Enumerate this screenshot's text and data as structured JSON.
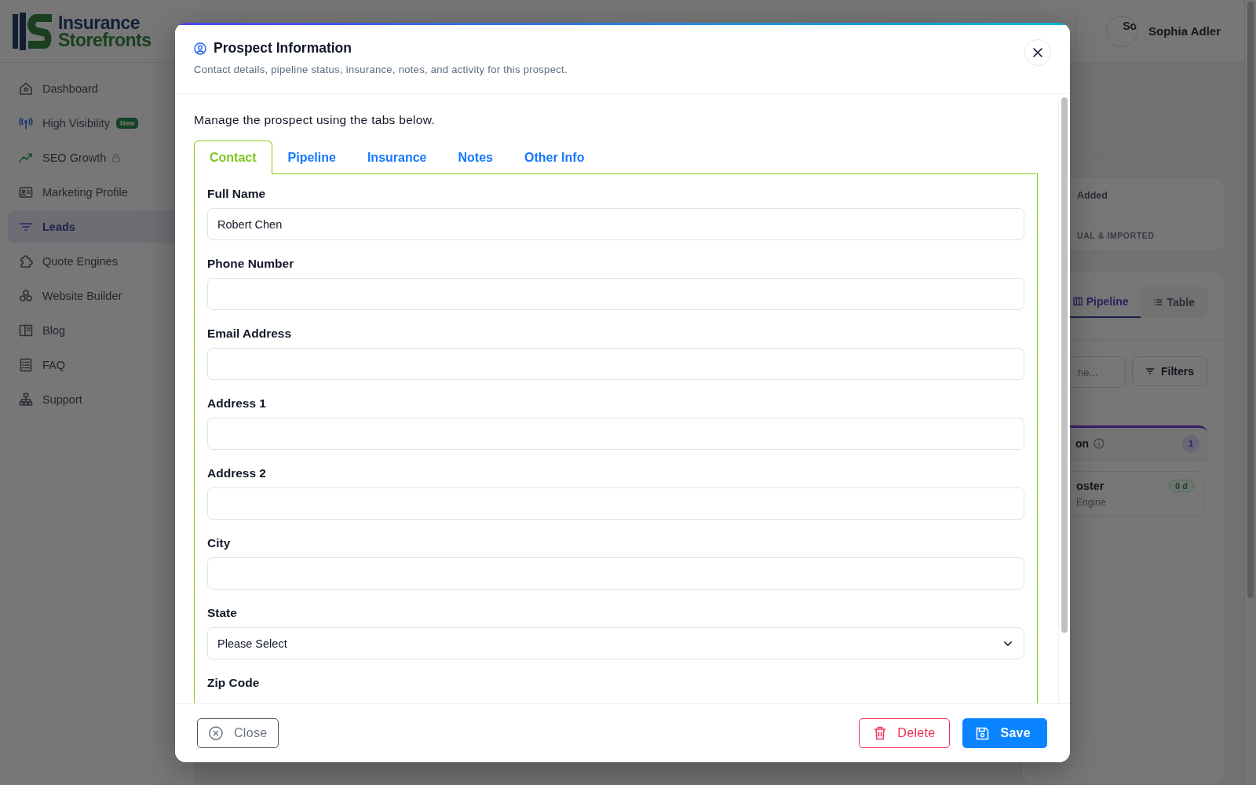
{
  "app": {
    "logo": {
      "line1": "Insurance",
      "line2": "Storefronts"
    },
    "user": {
      "name": "Sophia Adler",
      "avatar_alt": "So"
    }
  },
  "sidebar": {
    "items": [
      {
        "label": "Dashboard",
        "selected": false,
        "locked": false
      },
      {
        "label": "High Visibility",
        "selected": false,
        "locked": false,
        "badge": "New"
      },
      {
        "label": "SEO Growth",
        "selected": false,
        "locked": true
      },
      {
        "label": "Marketing Profile",
        "selected": false,
        "locked": false
      },
      {
        "label": "Leads",
        "selected": true,
        "locked": false
      },
      {
        "label": "Quote Engines",
        "selected": false,
        "locked": false
      },
      {
        "label": "Website Builder",
        "selected": false,
        "locked": false
      },
      {
        "label": "Blog",
        "selected": false,
        "locked": false
      },
      {
        "label": "FAQ",
        "selected": false,
        "locked": false
      },
      {
        "label": "Support",
        "selected": false,
        "locked": false
      }
    ]
  },
  "main": {
    "stats_card": {
      "label": "Added",
      "caption": "UAL & IMPORTED"
    },
    "view_tabs": [
      {
        "label": "Pipeline",
        "selected": true
      },
      {
        "label": "Table",
        "selected": false
      }
    ],
    "search": {
      "placeholder": "he..."
    },
    "filters_button": "Filters",
    "column": {
      "title": "on",
      "count": "1"
    },
    "lead_card": {
      "title": "oster",
      "subtitle": "Engine",
      "age": "0 d"
    }
  },
  "dialog": {
    "title": "Prospect Information",
    "subtitle": "Contact details, pipeline status, insurance, notes, and activity for this prospect.",
    "intro": "Manage the prospect using the tabs below.",
    "tabs": [
      {
        "label": "Contact",
        "selected": true
      },
      {
        "label": "Pipeline",
        "selected": false
      },
      {
        "label": "Insurance",
        "selected": false
      },
      {
        "label": "Notes",
        "selected": false
      },
      {
        "label": "Other Info",
        "selected": false
      }
    ],
    "fields": [
      {
        "label": "Full Name",
        "kind": "text",
        "value": "Robert Chen"
      },
      {
        "label": "Phone Number",
        "kind": "text"
      },
      {
        "label": "Email Address",
        "kind": "text"
      },
      {
        "label": "Address 1",
        "kind": "text"
      },
      {
        "label": "Address 2",
        "kind": "text"
      },
      {
        "label": "City",
        "kind": "text"
      },
      {
        "label": "State",
        "kind": "select",
        "value": "Please Select"
      },
      {
        "label": "Zip Code",
        "kind": "cut"
      }
    ],
    "buttons": [
      {
        "label": "Close",
        "kind": "close"
      },
      {
        "label": "Delete",
        "kind": "delete"
      },
      {
        "label": "Save",
        "kind": "save"
      }
    ]
  }
}
